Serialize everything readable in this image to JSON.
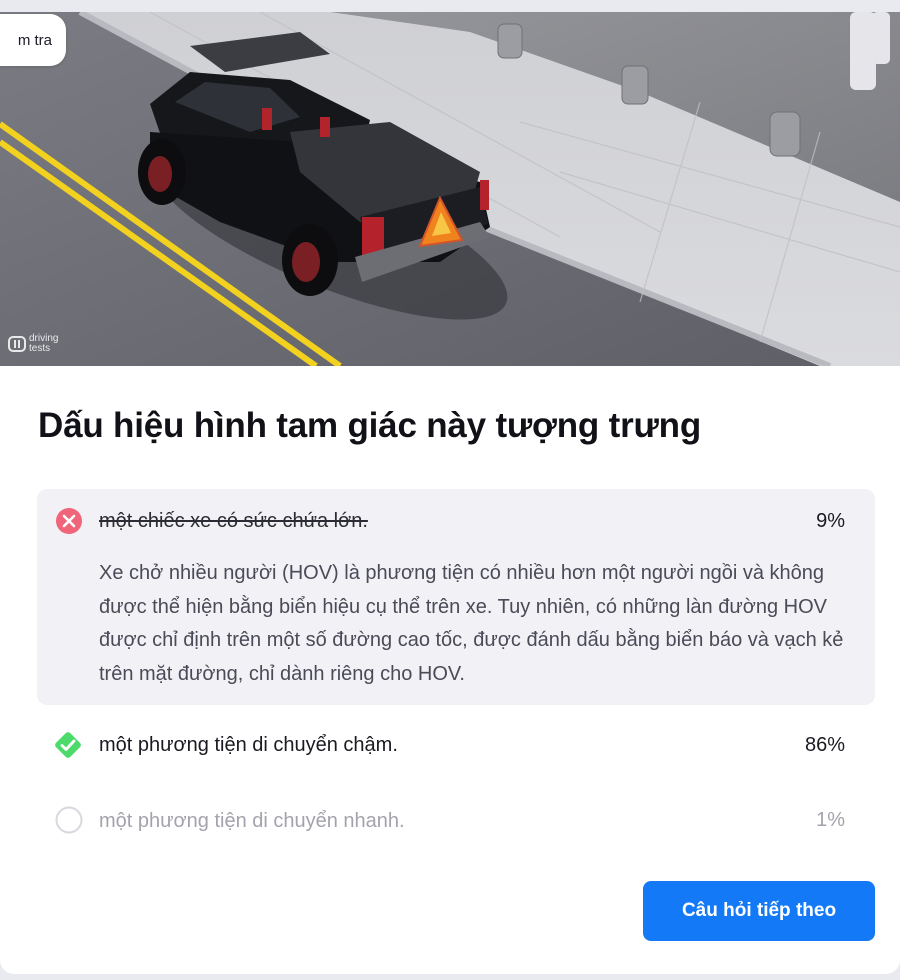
{
  "tab_chip": {
    "label": "m tra"
  },
  "image": {
    "watermark_line1": "driving",
    "watermark_line2": "tests"
  },
  "question": {
    "title": "Dấu hiệu hình tam giác này tượng trưng"
  },
  "options": [
    {
      "label": "một chiếc xe có sức chứa lớn.",
      "percent": "9%",
      "state": "wrong-selected",
      "icon": "x-circle-icon",
      "explanation": "Xe chở nhiều người (HOV) là phương tiện có nhiều hơn một người ngồi và không được thể hiện bằng biển hiệu cụ thể trên xe. Tuy nhiên, có những làn đường HOV được chỉ định trên một số đường cao tốc, được đánh dấu bằng biển báo và vạch kẻ trên mặt đường, chỉ dành riêng cho HOV."
    },
    {
      "label": "một phương tiện di chuyển chậm.",
      "percent": "86%",
      "state": "correct",
      "icon": "check-diamond-icon"
    },
    {
      "label": "một phương tiện di chuyển nhanh.",
      "percent": "1%",
      "state": "unselected",
      "icon": "empty-circle-icon"
    }
  ],
  "next_button": {
    "label": "Câu hỏi tiếp theo"
  },
  "colors": {
    "wrong": "#f0657a",
    "correct": "#4cdb6a",
    "accent": "#1379f7",
    "panel": "#f1f1f6"
  }
}
